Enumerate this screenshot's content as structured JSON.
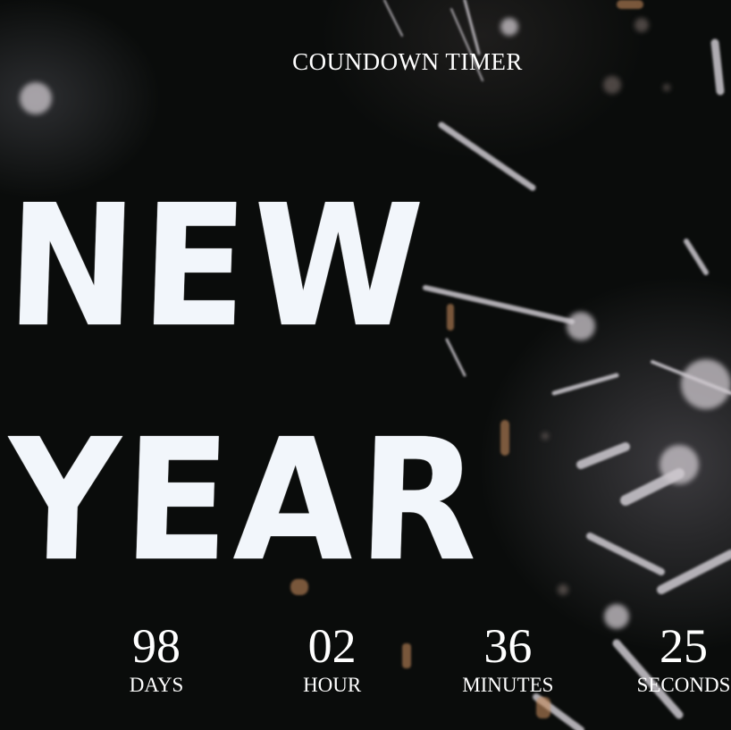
{
  "page": {
    "title": "COUNDOWN TIMER",
    "hero_line_1": "NEW",
    "hero_line_2": "YEAR"
  },
  "countdown": {
    "days": {
      "value": "98",
      "label": "DAYS"
    },
    "hours": {
      "value": "02",
      "label": "HOUR"
    },
    "minutes": {
      "value": "36",
      "label": "MINUTES"
    },
    "seconds": {
      "value": "25",
      "label": "SECONDS"
    }
  },
  "theme": {
    "background": "#0a0c0b",
    "text": "#ffffff",
    "hero_text": "#f2f6fb"
  }
}
